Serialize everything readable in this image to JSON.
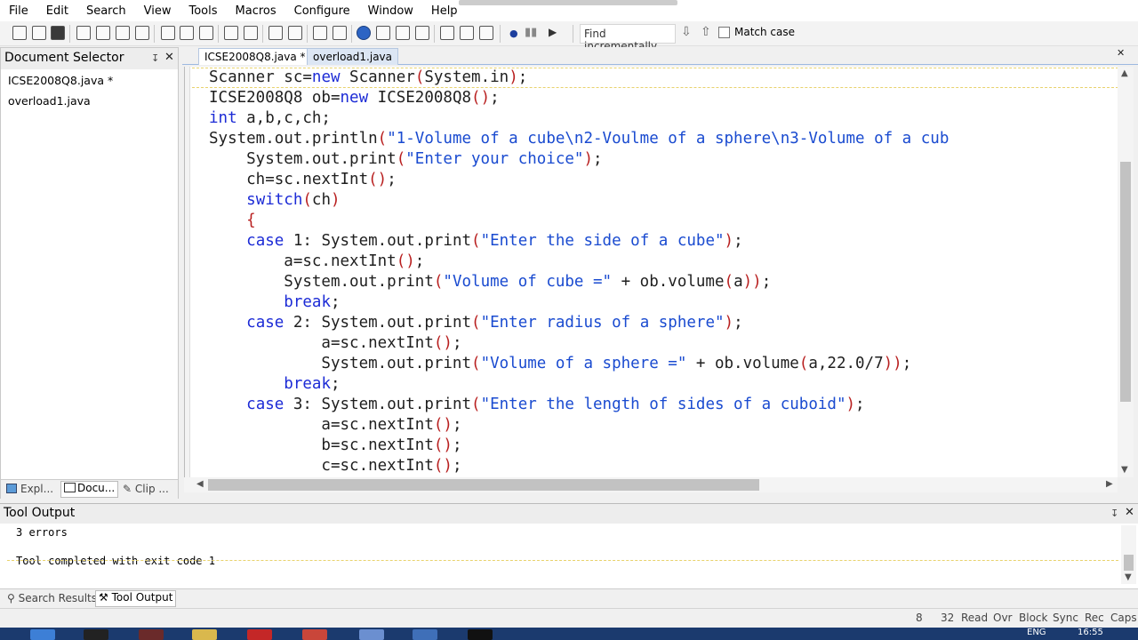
{
  "menu": [
    "File",
    "Edit",
    "Search",
    "View",
    "Tools",
    "Macros",
    "Configure",
    "Window",
    "Help"
  ],
  "toolbar": {
    "find_placeholder": "Find incrementally",
    "match_case": "Match case"
  },
  "doc_panel": {
    "title": "Document Selector",
    "pin": "↧",
    "close": "✕",
    "files": [
      "ICSE2008Q8.java *",
      "overload1.java"
    ],
    "tabs": [
      "Expl...",
      "Docu...",
      "Clip ..."
    ]
  },
  "editor": {
    "tabs": [
      {
        "label": "ICSE2008Q8.java *",
        "close": "✕"
      },
      {
        "label": "overload1.java"
      }
    ],
    "close": "✕",
    "lines": [
      [
        [
          "Scanner sc=",
          ""
        ],
        [
          "new",
          "kw"
        ],
        [
          " Scanner",
          ""
        ],
        [
          "(",
          "pr"
        ],
        [
          "System.in",
          ""
        ],
        [
          ")",
          "pr"
        ],
        [
          ";",
          ""
        ]
      ],
      [
        [
          "ICSE2008Q8 ob=",
          ""
        ],
        [
          "new",
          "kw"
        ],
        [
          " ICSE2008Q8",
          ""
        ],
        [
          "()",
          "pr"
        ],
        [
          ";",
          ""
        ]
      ],
      [
        [
          "int",
          "kw"
        ],
        [
          " a,b,c,ch;",
          ""
        ]
      ],
      [
        [
          "System.out.println",
          ""
        ],
        [
          "(",
          "pr"
        ],
        [
          "\"1-Volume of a cube\\n2-Voulme of a sphere\\n3-Volume of a cub",
          "str"
        ]
      ],
      [
        [
          "    System.out.print",
          ""
        ],
        [
          "(",
          "pr"
        ],
        [
          "\"Enter your choice\"",
          "str"
        ],
        [
          ")",
          "pr"
        ],
        [
          ";",
          ""
        ]
      ],
      [
        [
          "    ch=sc.nextInt",
          ""
        ],
        [
          "()",
          "pr"
        ],
        [
          ";",
          ""
        ]
      ],
      [
        [
          "    ",
          ""
        ],
        [
          "switch",
          "kw"
        ],
        [
          "(",
          "pr"
        ],
        [
          "ch",
          ""
        ],
        [
          ")",
          "pr"
        ]
      ],
      [
        [
          "    ",
          ""
        ],
        [
          "{",
          "pr"
        ]
      ],
      [
        [
          "    ",
          ""
        ],
        [
          "case",
          "kw"
        ],
        [
          " 1: System.out.print",
          ""
        ],
        [
          "(",
          "pr"
        ],
        [
          "\"Enter the side of a cube\"",
          "str"
        ],
        [
          ")",
          "pr"
        ],
        [
          ";",
          ""
        ]
      ],
      [
        [
          "        a=sc.nextInt",
          ""
        ],
        [
          "()",
          "pr"
        ],
        [
          ";",
          ""
        ]
      ],
      [
        [
          "        System.out.print",
          ""
        ],
        [
          "(",
          "pr"
        ],
        [
          "\"Volume of cube =\"",
          "str"
        ],
        [
          " + ob.volume",
          ""
        ],
        [
          "(",
          "pr"
        ],
        [
          "a",
          ""
        ],
        [
          "))",
          "pr"
        ],
        [
          ";",
          ""
        ]
      ],
      [
        [
          "        ",
          ""
        ],
        [
          "break",
          "kw"
        ],
        [
          ";",
          ""
        ]
      ],
      [
        [
          "    ",
          ""
        ],
        [
          "case",
          "kw"
        ],
        [
          " 2: System.out.print",
          ""
        ],
        [
          "(",
          "pr"
        ],
        [
          "\"Enter radius of a sphere\"",
          "str"
        ],
        [
          ")",
          "pr"
        ],
        [
          ";",
          ""
        ]
      ],
      [
        [
          "            a=sc.nextInt",
          ""
        ],
        [
          "()",
          "pr"
        ],
        [
          ";",
          ""
        ]
      ],
      [
        [
          "            System.out.print",
          ""
        ],
        [
          "(",
          "pr"
        ],
        [
          "\"Volume of a sphere =\"",
          "str"
        ],
        [
          " + ob.volume",
          ""
        ],
        [
          "(",
          "pr"
        ],
        [
          "a,22.0/7",
          ""
        ],
        [
          "))",
          "pr"
        ],
        [
          ";",
          ""
        ]
      ],
      [
        [
          "        ",
          ""
        ],
        [
          "break",
          "kw"
        ],
        [
          ";",
          ""
        ]
      ],
      [
        [
          "    ",
          ""
        ],
        [
          "case",
          "kw"
        ],
        [
          " 3: System.out.print",
          ""
        ],
        [
          "(",
          "pr"
        ],
        [
          "\"Enter the length of sides of a cuboid\"",
          "str"
        ],
        [
          ")",
          "pr"
        ],
        [
          ";",
          ""
        ]
      ],
      [
        [
          "            a=sc.nextInt",
          ""
        ],
        [
          "()",
          "pr"
        ],
        [
          ";",
          ""
        ]
      ],
      [
        [
          "            b=sc.nextInt",
          ""
        ],
        [
          "()",
          "pr"
        ],
        [
          ";",
          ""
        ]
      ],
      [
        [
          "            c=sc.nextInt",
          ""
        ],
        [
          "()",
          "pr"
        ],
        [
          ";",
          ""
        ]
      ]
    ]
  },
  "tool_panel": {
    "title": "Tool Output",
    "pin": "↧",
    "close": "✕",
    "output": [
      "3 errors",
      "",
      "Tool completed with exit code 1"
    ],
    "tabs": [
      "Search Results",
      "Tool Output"
    ]
  },
  "status": {
    "line": "8",
    "col": "32",
    "flags": [
      "Read",
      "Ovr",
      "Block",
      "Sync",
      "Rec",
      "Caps"
    ]
  },
  "taskbar": {
    "lang": "ENG",
    "time": "16:55"
  }
}
